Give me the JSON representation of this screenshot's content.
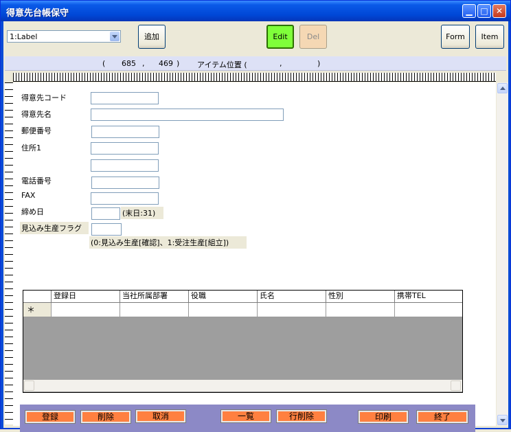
{
  "window": {
    "title": "得意先台帳保守"
  },
  "toolbar": {
    "combo_value": "1:Label",
    "add_label": "追加",
    "edit_label": "Edit",
    "del_label": "Del",
    "form_label": "Form",
    "item_label": "Item"
  },
  "posbar": {
    "open_paren": "(",
    "x": "685",
    "comma": ",",
    "y": "469",
    "close_paren": ")",
    "item_label": "アイテム位置 (",
    "item_comma": ",",
    "item_close": ")"
  },
  "form": {
    "code_label": "得意先コード",
    "name_label": "得意先名",
    "zip_label": "郵便番号",
    "addr_label": "住所1",
    "tel_label": "電話番号",
    "fax_label": "FAX",
    "close_label": "締め日",
    "close_hint": "(末日:31)",
    "flag_label": "見込み生産フラグ",
    "flag_hint": "(0:見込み生産[確認]、1:受注生産[組立])"
  },
  "grid": {
    "columns": [
      "登録日",
      "当社所属部署",
      "役職",
      "氏名",
      "性別",
      "携帯TEL"
    ],
    "new_row_marker": "＊"
  },
  "footer": {
    "register": "登録",
    "delete": "削除",
    "cancel": "取消",
    "list": "一覧",
    "row_delete": "行削除",
    "print": "印刷",
    "exit": "終了"
  }
}
